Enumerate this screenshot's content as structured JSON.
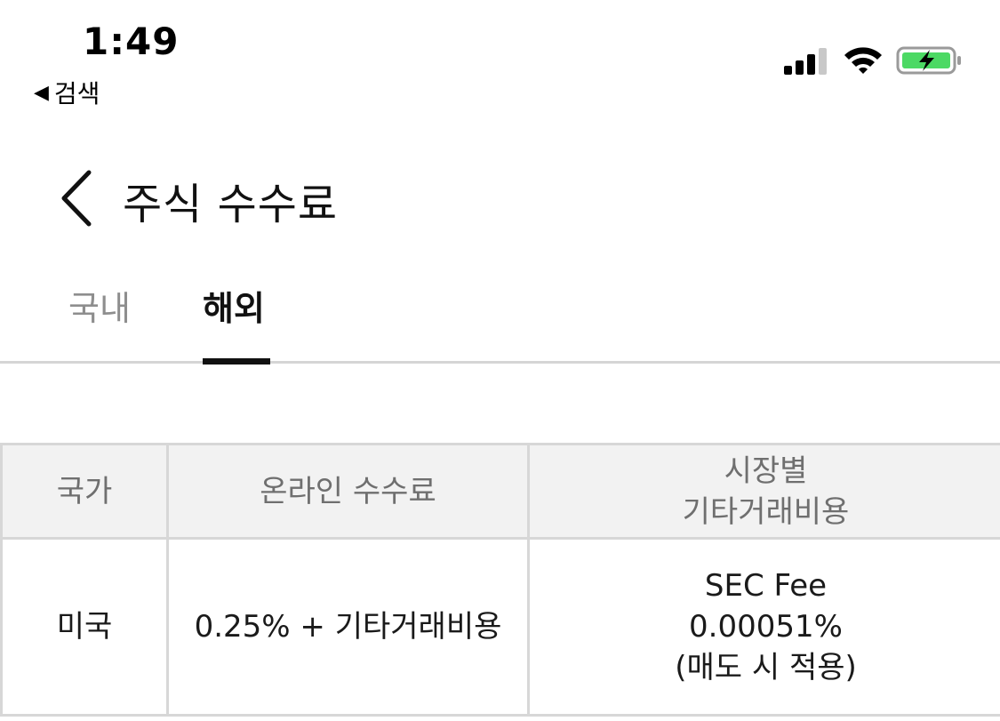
{
  "status_bar": {
    "time": "1:49",
    "back_label": "검색",
    "back_icon": "back-triangle-icon",
    "signal_icon": "cellular-signal-icon",
    "wifi_icon": "wifi-icon",
    "battery_icon": "battery-charging-icon",
    "battery_color": "#4cd964"
  },
  "header": {
    "back_icon": "chevron-left-icon",
    "title": "주식 수수료"
  },
  "tabs": [
    {
      "label": "국내",
      "active": false
    },
    {
      "label": "해외",
      "active": true
    }
  ],
  "table": {
    "headers": {
      "country": "국가",
      "online_fee": "온라인 수수료",
      "other_cost_line1": "시장별",
      "other_cost_line2": "기타거래비용"
    },
    "rows": [
      {
        "country": "미국",
        "online_fee": "0.25% + 기타거래비용",
        "other_cost_line1": "SEC Fee",
        "other_cost_line2": "0.00051%",
        "other_cost_line3": "(매도 시 적용)"
      }
    ]
  }
}
